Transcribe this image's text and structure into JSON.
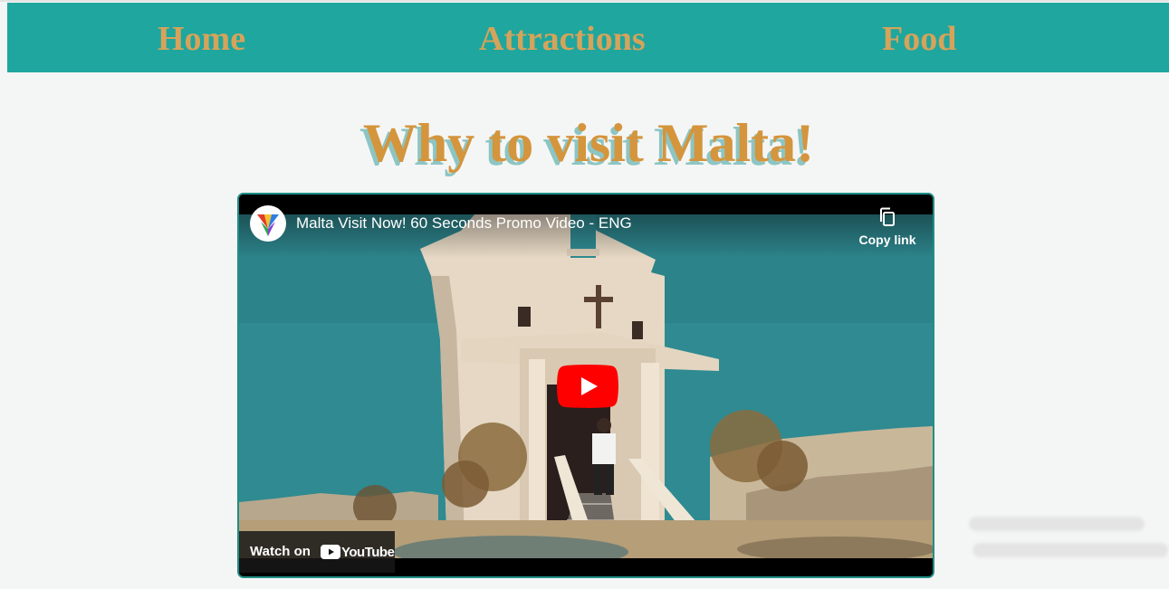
{
  "nav": {
    "items": [
      {
        "label": "Home"
      },
      {
        "label": "Attractions"
      },
      {
        "label": "Food"
      }
    ],
    "background": "#1fa69e",
    "text_color": "#d6a35a"
  },
  "page": {
    "title": "Why to visit Malta!",
    "title_color": "#d4953d"
  },
  "video": {
    "title": "Malta Visit Now! 60 Seconds Promo Video - ENG",
    "copy_link_label": "Copy link",
    "watch_on_label": "Watch on",
    "youtube_label": "YouTube",
    "play_icon": "youtube-play-icon",
    "copy_icon": "copy-icon"
  }
}
